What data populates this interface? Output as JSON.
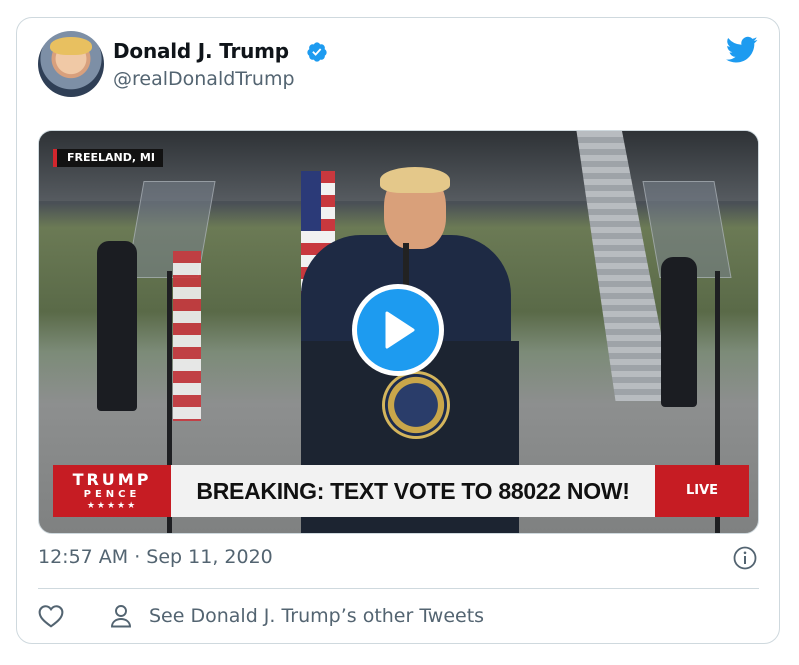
{
  "tweet": {
    "author_name": "Donald J. Trump",
    "handle": "@realDonaldTrump",
    "timestamp": "12:57 AM · Sep 11, 2020",
    "see_more": "See Donald J. Trump’s other Tweets"
  },
  "video": {
    "location_tag": "FREELAND, MI",
    "brand_line1": "TRUMP",
    "brand_line2": "PENCE",
    "brand_stars": "★★★★★",
    "headline": "BREAKING: TEXT VOTE TO 88022 NOW!",
    "live_label": "LIVE"
  },
  "icons": {
    "verified": "verified-badge-icon",
    "brand": "twitter-bird-icon",
    "play": "play-icon",
    "info": "info-icon",
    "like": "heart-icon",
    "profile": "person-icon"
  },
  "colors": {
    "twitter_blue": "#1d9bf0",
    "secondary_text": "#536471",
    "border": "#cfd9de",
    "broadcast_red": "#c61c23"
  }
}
